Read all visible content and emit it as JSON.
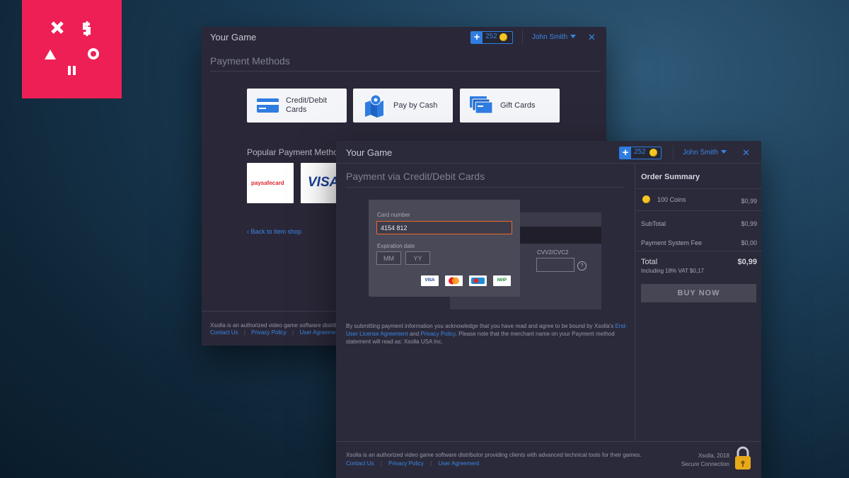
{
  "colors": {
    "accent": "#3a86e6",
    "brand": "#ee1f55",
    "coin": "#f3c623",
    "active_border": "#ea6a2c"
  },
  "back_window": {
    "title": "Your Game",
    "coins": "252",
    "user": "John Smith",
    "section_title": "Payment Methods",
    "methods": [
      {
        "label": "Credit/Debit Cards",
        "icon": "credit-card-icon"
      },
      {
        "label": "Pay by Cash",
        "icon": "map-pin-icon"
      },
      {
        "label": "Gift Cards",
        "icon": "gift-card-icon"
      }
    ],
    "popular_title": "Popular Payment Methods",
    "popular": [
      {
        "label": "paysafecard"
      },
      {
        "label": "VISA"
      }
    ],
    "back_link": "Back to item shop",
    "footer_text": "Xsolla is an authorized video game software distributor providing clients with advanced technical tools for their games.",
    "footer_links": [
      "Contact Us",
      "Privacy Policy",
      "User Agreement"
    ]
  },
  "front_window": {
    "title": "Your Game",
    "coins": "252",
    "user": "John Smith",
    "section_title": "Payment via Credit/Debit Cards",
    "card_number_label": "Card number",
    "card_number_value": "4154 812",
    "expiration_label": "Expiration date",
    "month_placeholder": "MM",
    "year_placeholder": "YY",
    "card_logos": [
      "VISA",
      "MC",
      "Maestro",
      "МИР"
    ],
    "cvv_label": "CVV2/CVC2",
    "cvv_help": "?",
    "legal_1": "By submitting payment information you acknowledge that you have read and agree to be bound by Xsolla's",
    "legal_link_1": "End-User License Agreement",
    "legal_and": "and",
    "legal_link_2": "Privacy Policy",
    "legal_2": ". Please note that the merchant name on your Payment method statement will read as: Xsolla USA Inc.",
    "order_summary": {
      "title": "Order Summary",
      "item": "100 Coins",
      "item_price": "$0,99",
      "subtotal_label": "SubTotal",
      "subtotal_value": "$0,99",
      "fee_label": "Payment System Fee",
      "fee_value": "$0,00",
      "total_label": "Total",
      "total_value": "$0,99",
      "vat_note": "Including 18% VAT $0,17",
      "buy_label": "BUY NOW"
    },
    "footer_text": "Xsolla is an authorized video game software distributor providing clients with advanced technical tools for their games.",
    "footer_links": [
      "Contact Us",
      "Privacy Policy",
      "User Agreement"
    ],
    "copyright": "Xsolla, 2018",
    "secure": "Secure Connection"
  }
}
